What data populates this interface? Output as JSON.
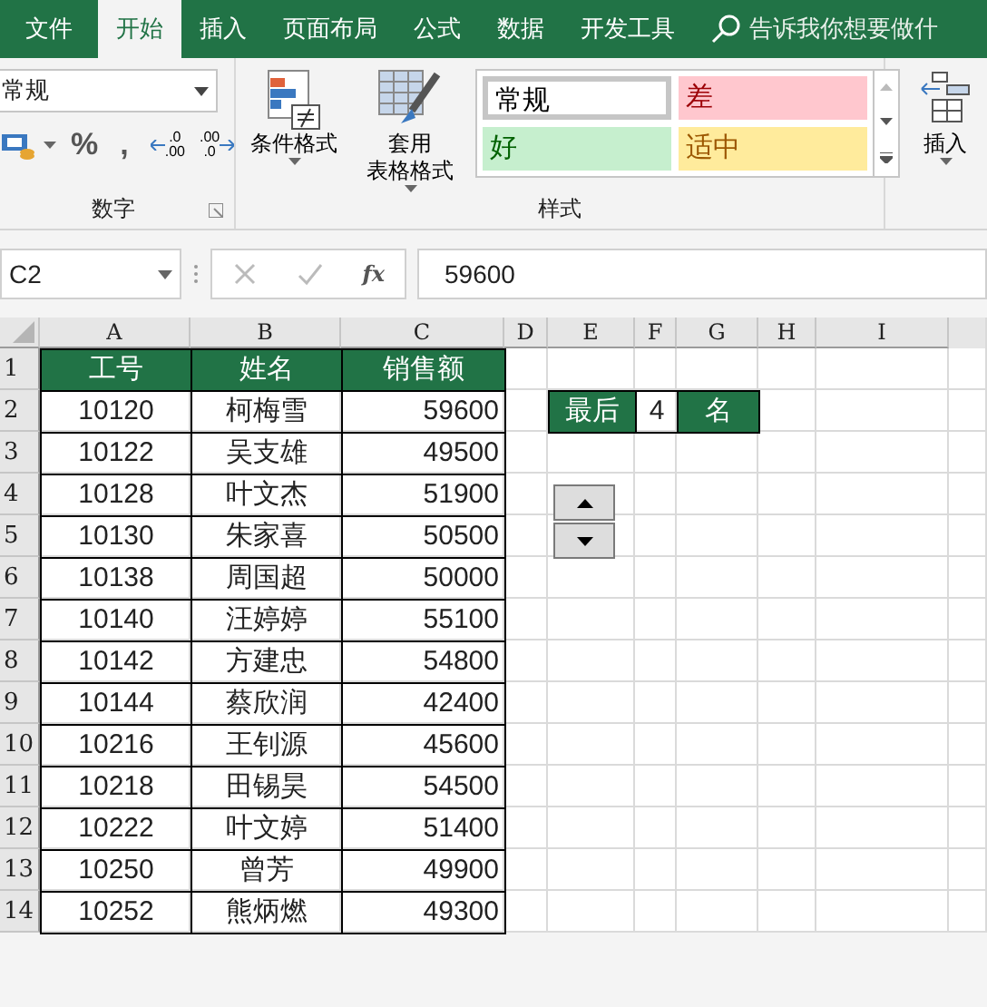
{
  "ribbon_tabs": [
    {
      "label": "文件",
      "selected": false
    },
    {
      "label": "开始",
      "selected": true
    },
    {
      "label": "插入",
      "selected": false
    },
    {
      "label": "页面布局",
      "selected": false
    },
    {
      "label": "公式",
      "selected": false
    },
    {
      "label": "数据",
      "selected": false
    },
    {
      "label": "开发工具",
      "selected": false
    }
  ],
  "tell_me": {
    "placeholder": "告诉我你想要做什"
  },
  "number_group": {
    "format": "常规",
    "symbol_buttons": [
      "%",
      ","
    ],
    "decimal_buttons": [
      {
        "kind": "decrease",
        "top": ".0",
        "bottom": ".00"
      },
      {
        "kind": "increase",
        "top": ".00",
        "bottom": ".0"
      }
    ],
    "label": "数字"
  },
  "styles_group": {
    "buttons": [
      {
        "lines": [
          "条件格式"
        ],
        "kind": "conditional"
      },
      {
        "lines": [
          "套用",
          "表格格式"
        ],
        "kind": "table"
      }
    ],
    "styles": [
      {
        "label": "常规",
        "kind": "normal"
      },
      {
        "label": "差",
        "kind": "bad"
      },
      {
        "label": "好",
        "kind": "good"
      },
      {
        "label": "适中",
        "kind": "neutral"
      }
    ],
    "label": "样式"
  },
  "cells_group": {
    "buttons": [
      "插入"
    ]
  },
  "formula_bar": {
    "name_box": "C2",
    "function_label": "fx",
    "value": "59600"
  },
  "column_headers": [
    "A",
    "B",
    "C",
    "D",
    "E",
    "F",
    "G",
    "H",
    "I"
  ],
  "row_numbers": [
    "1",
    "2",
    "3",
    "4",
    "5",
    "6",
    "7",
    "8",
    "9",
    "10",
    "11",
    "12",
    "13",
    "14"
  ],
  "table": {
    "columns": [
      "工号",
      "姓名",
      "销售额"
    ],
    "rows": [
      [
        "10120",
        "柯梅雪",
        "59600"
      ],
      [
        "10122",
        "吴支雄",
        "49500"
      ],
      [
        "10128",
        "叶文杰",
        "51900"
      ],
      [
        "10130",
        "朱家喜",
        "50500"
      ],
      [
        "10138",
        "周国超",
        "50000"
      ],
      [
        "10140",
        "汪婷婷",
        "55100"
      ],
      [
        "10142",
        "方建忠",
        "54800"
      ],
      [
        "10144",
        "蔡欣润",
        "42400"
      ],
      [
        "10216",
        "王钊源",
        "45600"
      ],
      [
        "10218",
        "田锡昊",
        "54500"
      ],
      [
        "10222",
        "叶文婷",
        "51400"
      ],
      [
        "10250",
        "曾芳",
        "49900"
      ],
      [
        "10252",
        "熊炳燃",
        "49300"
      ]
    ]
  },
  "rank_label": {
    "prefix": "最后",
    "count": "4",
    "suffix": "名"
  }
}
